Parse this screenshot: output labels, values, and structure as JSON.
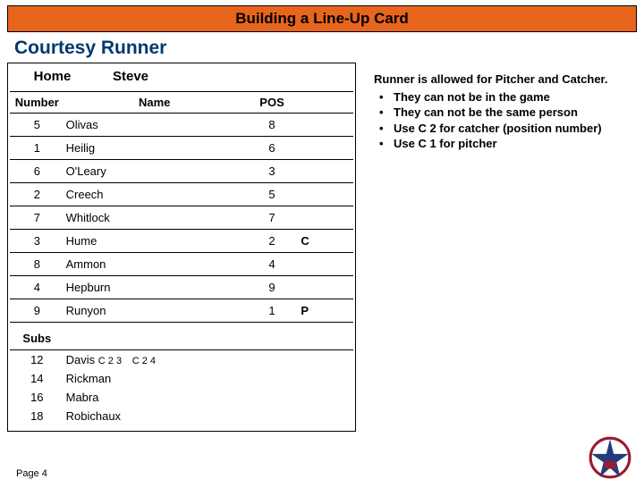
{
  "title": "Building a Line-Up Card",
  "subtitle": "Courtesy Runner",
  "card": {
    "home_label": "Home",
    "coach": "Steve",
    "columns": {
      "number": "Number",
      "name": "Name",
      "pos": "POS"
    },
    "rows": [
      {
        "num": "5",
        "name": "Olivas",
        "pos": "8",
        "extra": ""
      },
      {
        "num": "1",
        "name": "Heilig",
        "pos": "6",
        "extra": ""
      },
      {
        "num": "6",
        "name": "O'Leary",
        "pos": "3",
        "extra": ""
      },
      {
        "num": "2",
        "name": "Creech",
        "pos": "5",
        "extra": ""
      },
      {
        "num": "7",
        "name": "Whitlock",
        "pos": "7",
        "extra": ""
      },
      {
        "num": "3",
        "name": "Hume",
        "pos": "2",
        "extra": "C"
      },
      {
        "num": "8",
        "name": "Ammon",
        "pos": "4",
        "extra": ""
      },
      {
        "num": "4",
        "name": "Hepburn",
        "pos": "9",
        "extra": ""
      },
      {
        "num": "9",
        "name": "Runyon",
        "pos": "1",
        "extra": "P"
      }
    ],
    "subs_label": "Subs",
    "subs": [
      {
        "num": "12",
        "name": "Davis",
        "anno1": "C 2 3",
        "anno2": "C 2  4"
      },
      {
        "num": "14",
        "name": "Rickman"
      },
      {
        "num": "16",
        "name": "Mabra"
      },
      {
        "num": "18",
        "name": "Robichaux"
      }
    ]
  },
  "rules": {
    "intro": "Runner is allowed for Pitcher and Catcher.",
    "items": [
      "They can not be in the game",
      "They can not be the same person",
      "Use C 2 for catcher (position number)",
      "Use C 1 for pitcher"
    ]
  },
  "footer": "Page 4"
}
